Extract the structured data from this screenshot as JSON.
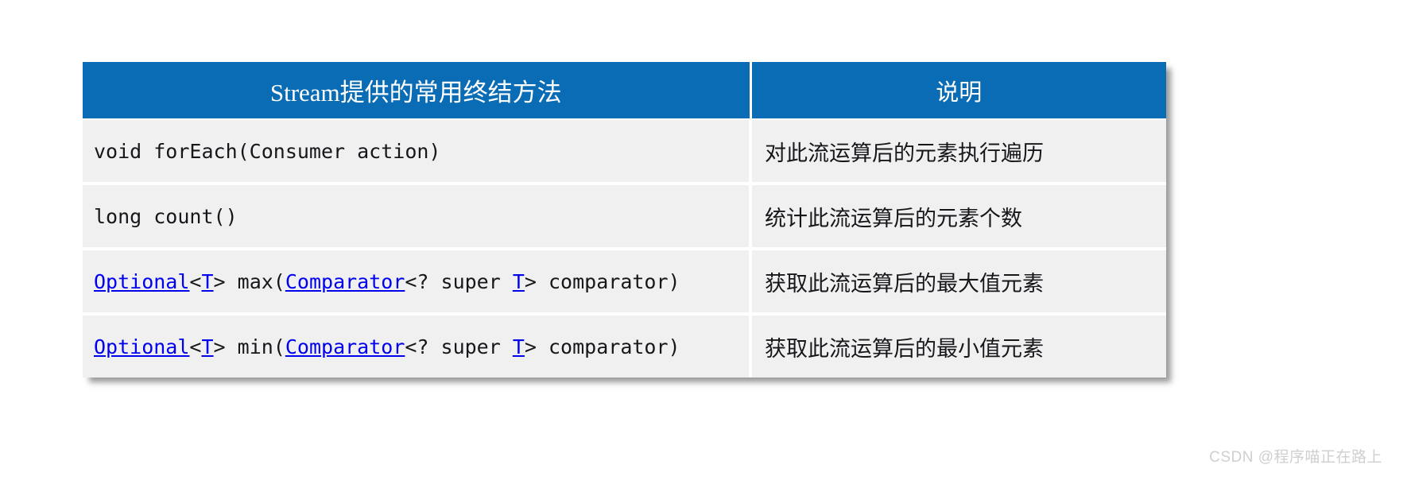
{
  "table": {
    "headers": {
      "signature": "Stream提供的常用终结方法",
      "description": "说明"
    },
    "rows": [
      {
        "signature_text": "void forEach(Consumer action)",
        "signature_tokens": [
          {
            "text": "void forEach(Consumer action)",
            "link": false
          }
        ],
        "description": "对此流运算后的元素执行遍历"
      },
      {
        "signature_text": "long count()",
        "signature_tokens": [
          {
            "text": "long count()",
            "link": false
          }
        ],
        "description": "统计此流运算后的元素个数"
      },
      {
        "signature_text": "Optional<T> max(Comparator<? super T> comparator)",
        "signature_tokens": [
          {
            "text": "Optional",
            "link": true
          },
          {
            "text": "<",
            "link": false
          },
          {
            "text": "T",
            "link": true
          },
          {
            "text": "> max(",
            "link": false
          },
          {
            "text": "Comparator",
            "link": true
          },
          {
            "text": "<? super ",
            "link": false
          },
          {
            "text": "T",
            "link": true
          },
          {
            "text": "> comparator)",
            "link": false
          }
        ],
        "description": "获取此流运算后的最大值元素"
      },
      {
        "signature_text": "Optional<T> min(Comparator<? super T> comparator)",
        "signature_tokens": [
          {
            "text": "Optional",
            "link": true
          },
          {
            "text": "<",
            "link": false
          },
          {
            "text": "T",
            "link": true
          },
          {
            "text": "> min(",
            "link": false
          },
          {
            "text": "Comparator",
            "link": true
          },
          {
            "text": "<? super ",
            "link": false
          },
          {
            "text": "T",
            "link": true
          },
          {
            "text": "> comparator)",
            "link": false
          }
        ],
        "description": "获取此流运算后的最小值元素"
      }
    ]
  },
  "watermark": {
    "text": "CSDN @程序喵正在路上"
  },
  "colors": {
    "header_background": "#0a6cb5",
    "header_text": "#ffffff",
    "row_background": "#f0f0f0",
    "row_divider": "#ffffff",
    "code_link": "#0000ee",
    "body_text": "#17171b",
    "page_background": "#ffffff",
    "watermark_text": "#cfcfcf"
  }
}
